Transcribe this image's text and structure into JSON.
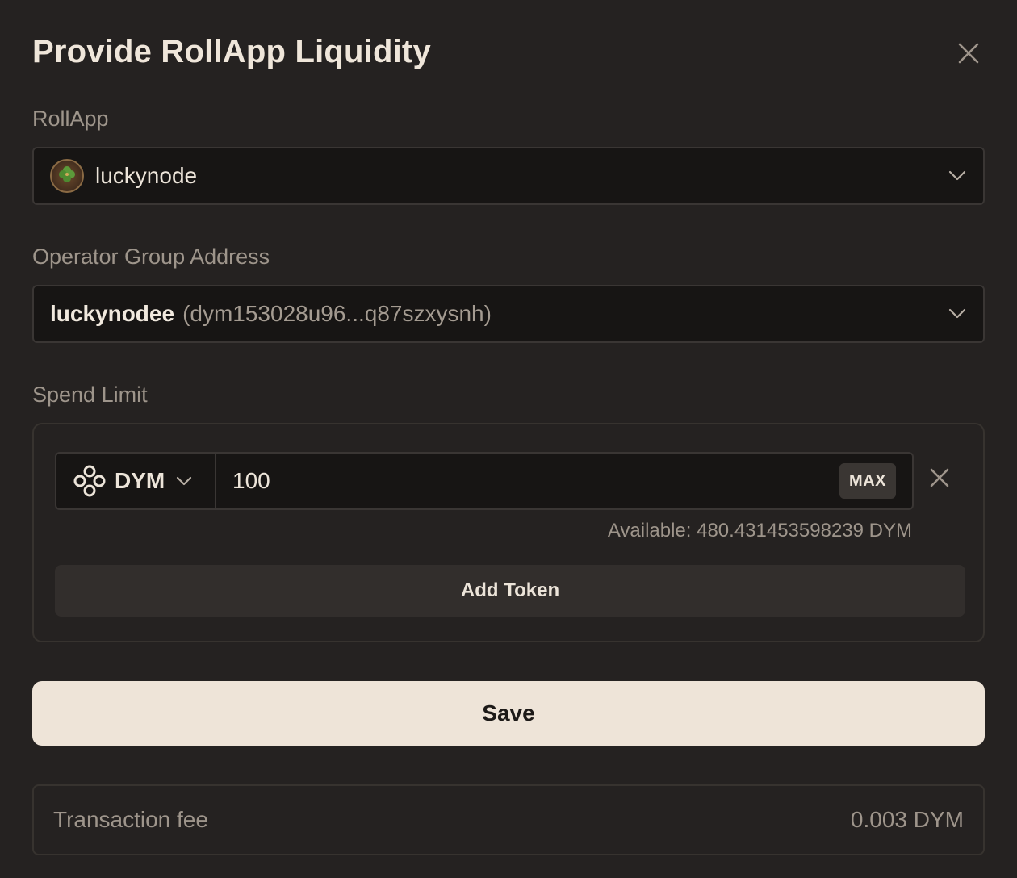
{
  "modal": {
    "title": "Provide RollApp Liquidity",
    "close_icon": "close-icon"
  },
  "rollapp": {
    "label": "RollApp",
    "selected_name": "luckynode",
    "avatar_icon": "clover-icon"
  },
  "operator": {
    "label": "Operator Group Address",
    "selected_name": "luckynodee",
    "selected_address": "(dym153028u96...q87szxysnh)"
  },
  "spend_limit": {
    "label": "Spend Limit",
    "token_symbol": "DYM",
    "token_icon": "dym-knot-icon",
    "amount_value": "100",
    "max_label": "MAX",
    "available_text": "Available: 480.431453598239 DYM",
    "add_token_label": "Add Token"
  },
  "actions": {
    "save_label": "Save"
  },
  "fee": {
    "label": "Transaction fee",
    "value": "0.003 DYM"
  },
  "colors": {
    "background": "#252221",
    "input_background": "#171514",
    "primary_button": "#eee4d8",
    "muted_text": "#9e958b"
  }
}
